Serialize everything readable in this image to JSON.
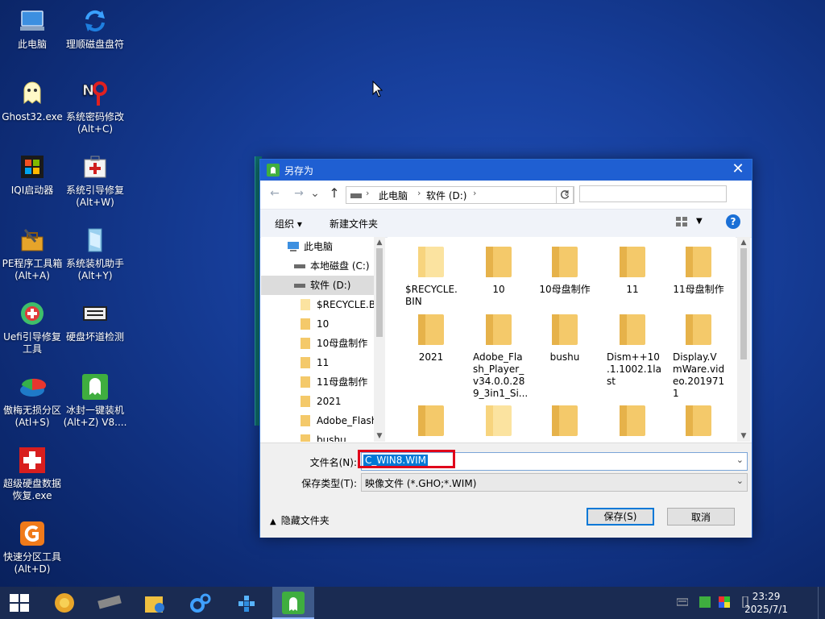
{
  "desktop": {
    "icons": [
      {
        "label": "此电脑",
        "icon": "computer-icon"
      },
      {
        "label": "理顺磁盘盘符",
        "icon": "refresh-arrows-icon"
      },
      {
        "label": "Ghost32.exe",
        "icon": "ghost-icon"
      },
      {
        "label": "系统密码修改\n(Alt+C)",
        "icon": "password-key-icon"
      },
      {
        "label": "IQI启动器",
        "icon": "windows-logo-icon"
      },
      {
        "label": "系统引导修复\n(Alt+W)",
        "icon": "first-aid-kit-icon"
      },
      {
        "label": "PE程序工具箱\n(Alt+A)",
        "icon": "toolbox-icon"
      },
      {
        "label": "系统装机助手\n(Alt+Y)",
        "icon": "install-assistant-icon"
      },
      {
        "label": "Uefi引导修复\n工具",
        "icon": "uefi-repair-icon"
      },
      {
        "label": "硬盘坏道检测",
        "icon": "disk-check-icon"
      },
      {
        "label": "傲梅无损分区\n(Atl+S)",
        "icon": "partition-icon"
      },
      {
        "label": "冰封一键装机\n(Alt+Z) V8....",
        "icon": "ghost-installer-icon"
      },
      {
        "label": "超级硬盘数据\n恢复.exe",
        "icon": "data-recovery-icon"
      },
      {
        "label": "快速分区工具\n(Alt+D)",
        "icon": "diskgenius-icon"
      }
    ]
  },
  "dialog": {
    "title": "另存为",
    "close_label": "✕",
    "address": {
      "root": "此电脑",
      "drive": "软件 (D:)"
    },
    "search_placeholder": "",
    "toolbar": {
      "organize": "组织 ▾",
      "new_folder": "新建文件夹",
      "help": "?"
    },
    "tree": [
      {
        "label": "此电脑",
        "icon": "computer-icon",
        "selected": false
      },
      {
        "label": "本地磁盘 (C:)",
        "icon": "drive-icon",
        "selected": false
      },
      {
        "label": "软件 (D:)",
        "icon": "drive-icon",
        "selected": true
      },
      {
        "label": "$RECYCLE.BIN",
        "icon": "folder-icon",
        "selected": false
      },
      {
        "label": "10",
        "icon": "folder-icon",
        "selected": false
      },
      {
        "label": "10母盘制作",
        "icon": "folder-icon",
        "selected": false
      },
      {
        "label": "11",
        "icon": "folder-icon",
        "selected": false
      },
      {
        "label": "11母盘制作",
        "icon": "folder-icon",
        "selected": false
      },
      {
        "label": "2021",
        "icon": "folder-icon",
        "selected": false
      },
      {
        "label": "Adobe_Flash",
        "icon": "folder-icon",
        "selected": false
      },
      {
        "label": "bushu",
        "icon": "folder-icon",
        "selected": false
      }
    ],
    "files": [
      {
        "name": "$RECYCLE.\nBIN",
        "faded": true
      },
      {
        "name": "10",
        "faded": false
      },
      {
        "name": "10母盘制作",
        "faded": false
      },
      {
        "name": "11",
        "faded": false
      },
      {
        "name": "11母盘制作",
        "faded": false
      },
      {
        "name": "2021",
        "faded": false
      },
      {
        "name": "Adobe_Fla\nsh_Player_\nv34.0.0.28\n9_3in1_Si...",
        "faded": false
      },
      {
        "name": "bushu",
        "faded": false
      },
      {
        "name": "Dism++10\n.1.1002.1la\nst",
        "faded": false
      },
      {
        "name": "Display.V\nmWare.vid\neo.201971\n1",
        "faded": false
      },
      {
        "name": "",
        "faded": false
      },
      {
        "name": "",
        "faded": true
      },
      {
        "name": "",
        "faded": false
      },
      {
        "name": "",
        "faded": false
      },
      {
        "name": "",
        "faded": false
      }
    ],
    "filename_label": "文件名(N):",
    "filename_value": "C_WIN8.WIM",
    "filetype_label": "保存类型(T):",
    "filetype_value": "映像文件 (*.GHO;*.WIM)",
    "hide_folders": "隐藏文件夹",
    "save_button": "保存(S)",
    "cancel_button": "取消"
  },
  "taskbar": {
    "time": "23:29",
    "date": "2025/7/1"
  },
  "colors": {
    "titlebar": "#1f5fd2",
    "highlight": "#0078d7",
    "annotation_box": "#e0001b",
    "folder": "#f4c96a"
  }
}
